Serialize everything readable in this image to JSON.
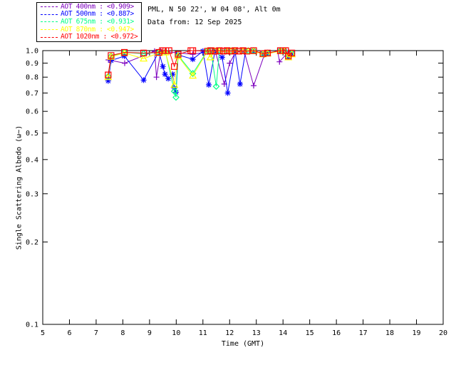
{
  "header": {
    "station_line": "PML, N 50 22', W 04 08', Alt 0m",
    "date_line": "Data from: 12 Sep 2025"
  },
  "legend": {
    "entries": [
      {
        "label": "AOT  400nm : <0.909>",
        "wavelength": "400nm",
        "mean": "<0.909>",
        "color": "#7d00be",
        "marker": "plus"
      },
      {
        "label": "AOT  500nm : <0.887>",
        "wavelength": "500nm",
        "mean": "<0.887>",
        "color": "#0000ff",
        "marker": "asterisk"
      },
      {
        "label": "AOT  675nm : <0.931>",
        "wavelength": "675nm",
        "mean": "<0.931>",
        "color": "#00ff87",
        "marker": "diamond"
      },
      {
        "label": "AOT  870nm : <0.947>",
        "wavelength": "870nm",
        "mean": "<0.947>",
        "color": "#ffff00",
        "marker": "triangle"
      },
      {
        "label": "AOT 1020nm : <0.972>",
        "wavelength": "1020nm",
        "mean": "<0.972>",
        "color": "#ff0000",
        "marker": "square"
      }
    ]
  },
  "chart_data": {
    "type": "line",
    "title": "",
    "xlabel": "Time (GMT)",
    "ylabel": "Single Scattering Albedo (ω~)",
    "xlim": [
      5,
      20
    ],
    "ylim": [
      0.1,
      1.0
    ],
    "yscale": "log",
    "grid": false,
    "legend_position": "top-left",
    "xticks": [
      5,
      6,
      7,
      8,
      9,
      10,
      11,
      12,
      13,
      14,
      15,
      16,
      17,
      18,
      19,
      20
    ],
    "yticks": [
      "1.0",
      "0.9",
      "0.8",
      "0.7",
      "0.6",
      "0.5",
      "0.4",
      "0.3",
      "0.2",
      "0.1"
    ],
    "axis_color": "#000000",
    "series": [
      {
        "name": "AOT 400nm",
        "color": "#7d00be",
        "marker": "plus",
        "points": [
          [
            7.46,
            0.925
          ],
          [
            8.07,
            0.9
          ],
          [
            9.19,
            0.995
          ],
          [
            9.26,
            0.8
          ],
          [
            9.42,
            0.995
          ],
          [
            10.62,
            0.97
          ],
          [
            11.17,
            0.99
          ],
          [
            11.47,
            0.99
          ],
          [
            11.8,
            0.755
          ],
          [
            12.0,
            0.9
          ],
          [
            12.23,
            0.99
          ],
          [
            12.55,
            0.99
          ],
          [
            12.9,
            0.745
          ],
          [
            13.3,
            0.965
          ],
          [
            13.8,
            0.995
          ],
          [
            13.87,
            0.91
          ],
          [
            14.2,
            0.99
          ]
        ]
      },
      {
        "name": "AOT 500nm",
        "color": "#0000ff",
        "marker": "asterisk",
        "points": [
          [
            7.45,
            0.775
          ],
          [
            7.56,
            0.92
          ],
          [
            8.06,
            0.955
          ],
          [
            8.78,
            0.78
          ],
          [
            9.35,
            0.99
          ],
          [
            9.5,
            0.875
          ],
          [
            9.58,
            0.82
          ],
          [
            9.7,
            0.79
          ],
          [
            9.86,
            0.82
          ],
          [
            9.93,
            0.73
          ],
          [
            9.99,
            0.705
          ],
          [
            10.07,
            0.965
          ],
          [
            10.62,
            0.93
          ],
          [
            11.0,
            0.995
          ],
          [
            11.22,
            0.75
          ],
          [
            11.45,
            0.995
          ],
          [
            11.72,
            0.945
          ],
          [
            11.93,
            0.7
          ],
          [
            12.2,
            0.995
          ],
          [
            12.39,
            0.755
          ],
          [
            12.6,
            0.995
          ],
          [
            12.9,
            0.995
          ],
          [
            13.25,
            0.975
          ],
          [
            13.42,
            0.98
          ],
          [
            13.9,
            0.995
          ],
          [
            14.05,
            0.995
          ],
          [
            14.2,
            0.95
          ],
          [
            14.33,
            0.975
          ]
        ]
      },
      {
        "name": "AOT 675nm",
        "color": "#00ff87",
        "marker": "diamond",
        "points": [
          [
            7.45,
            0.805
          ],
          [
            7.56,
            0.955
          ],
          [
            8.06,
            0.985
          ],
          [
            8.78,
            0.975
          ],
          [
            9.35,
            0.985
          ],
          [
            9.6,
            0.99
          ],
          [
            9.93,
            0.71
          ],
          [
            9.99,
            0.675
          ],
          [
            10.07,
            0.96
          ],
          [
            10.62,
            0.825
          ],
          [
            11.17,
            1.0
          ],
          [
            11.3,
            1.0
          ],
          [
            11.5,
            0.74
          ],
          [
            11.62,
            1.0
          ],
          [
            11.9,
            1.0
          ],
          [
            12.05,
            1.0
          ],
          [
            12.2,
            1.0
          ],
          [
            12.5,
            1.0
          ],
          [
            12.7,
            1.0
          ],
          [
            12.9,
            1.0
          ],
          [
            13.25,
            0.975
          ],
          [
            13.42,
            0.98
          ],
          [
            13.9,
            1.0
          ],
          [
            14.05,
            1.0
          ],
          [
            14.2,
            0.95
          ],
          [
            14.33,
            0.975
          ]
        ]
      },
      {
        "name": "AOT 870nm",
        "color": "#ffff00",
        "marker": "triangle",
        "points": [
          [
            7.45,
            0.8
          ],
          [
            7.56,
            0.95
          ],
          [
            8.06,
            0.98
          ],
          [
            8.78,
            0.935
          ],
          [
            9.35,
            0.98
          ],
          [
            9.6,
            0.985
          ],
          [
            9.93,
            0.75
          ],
          [
            10.07,
            0.955
          ],
          [
            10.62,
            0.81
          ],
          [
            11.17,
            0.995
          ],
          [
            11.28,
            0.945
          ],
          [
            11.45,
            0.995
          ],
          [
            11.62,
            0.995
          ],
          [
            11.9,
            0.995
          ],
          [
            12.05,
            0.995
          ],
          [
            12.2,
            0.995
          ],
          [
            12.5,
            0.995
          ],
          [
            12.7,
            0.995
          ],
          [
            12.9,
            0.995
          ],
          [
            13.25,
            0.97
          ],
          [
            13.42,
            0.975
          ],
          [
            13.9,
            0.995
          ],
          [
            14.05,
            0.995
          ],
          [
            14.2,
            0.945
          ],
          [
            14.33,
            0.97
          ]
        ]
      },
      {
        "name": "AOT 1020nm",
        "color": "#ff0000",
        "marker": "square",
        "points": [
          [
            7.45,
            0.815
          ],
          [
            7.56,
            0.96
          ],
          [
            8.06,
            0.985
          ],
          [
            8.78,
            0.98
          ],
          [
            9.35,
            0.985
          ],
          [
            9.48,
            1.0
          ],
          [
            9.61,
            1.0
          ],
          [
            9.73,
            1.0
          ],
          [
            9.93,
            0.875
          ],
          [
            10.07,
            0.97
          ],
          [
            10.55,
            1.0
          ],
          [
            10.62,
            1.0
          ],
          [
            11.17,
            0.995
          ],
          [
            11.3,
            1.0
          ],
          [
            11.45,
            0.995
          ],
          [
            11.62,
            1.0
          ],
          [
            11.77,
            0.995
          ],
          [
            11.9,
            1.0
          ],
          [
            12.05,
            0.995
          ],
          [
            12.2,
            1.0
          ],
          [
            12.35,
            0.995
          ],
          [
            12.5,
            1.0
          ],
          [
            12.65,
            0.995
          ],
          [
            12.9,
            1.0
          ],
          [
            13.25,
            0.975
          ],
          [
            13.42,
            0.98
          ],
          [
            13.9,
            1.0
          ],
          [
            14.0,
            1.0
          ],
          [
            14.1,
            1.0
          ],
          [
            14.2,
            0.955
          ],
          [
            14.33,
            0.98
          ]
        ]
      }
    ]
  }
}
